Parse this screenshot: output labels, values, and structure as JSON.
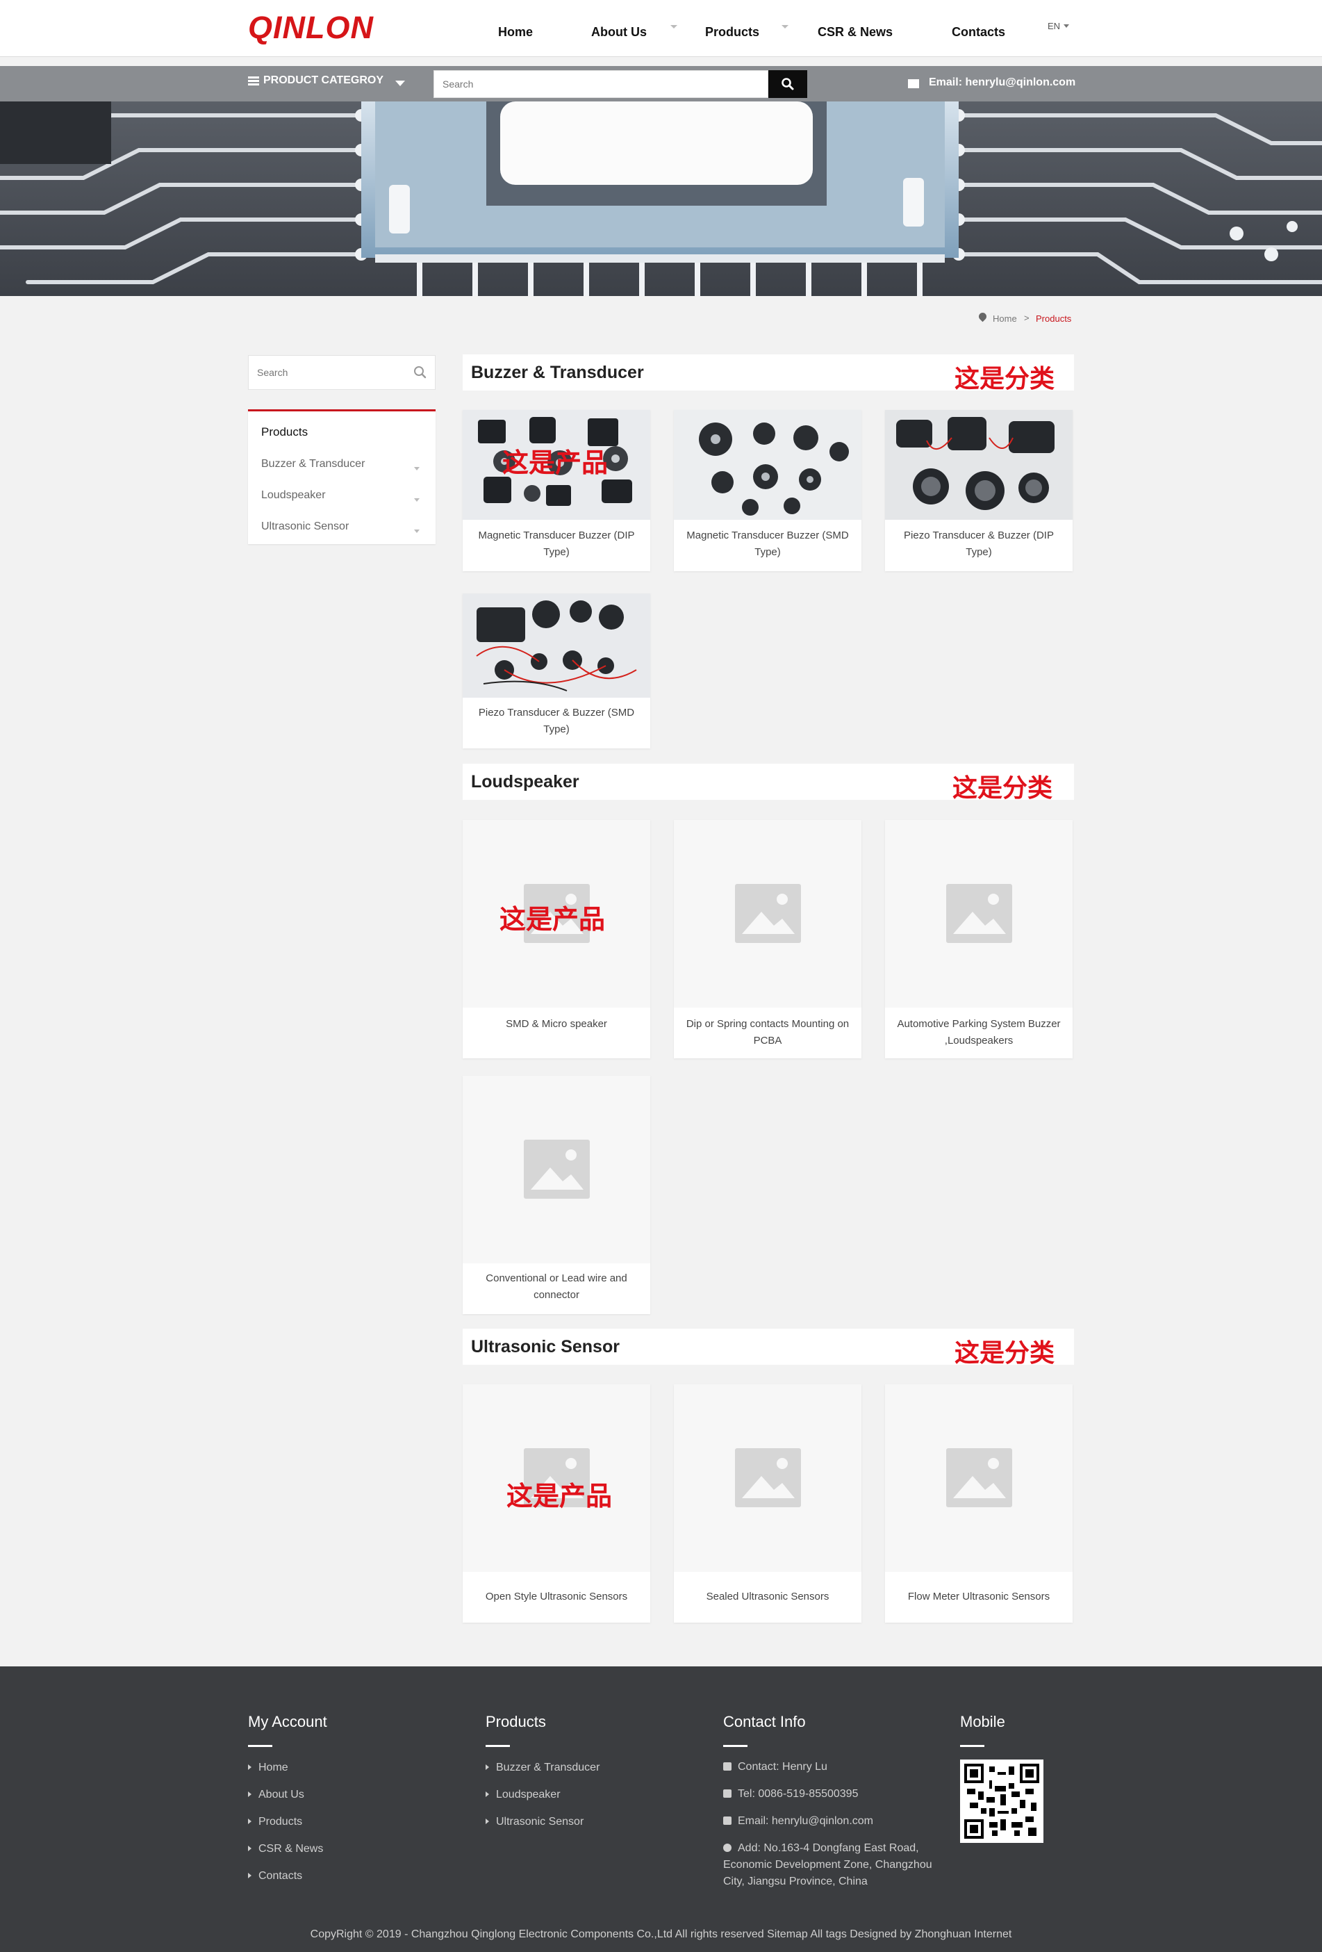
{
  "header": {
    "logo": "QINLON",
    "nav": [
      {
        "label": "Home"
      },
      {
        "label": "About Us"
      },
      {
        "label": "Products"
      },
      {
        "label": "CSR & News"
      },
      {
        "label": "Contacts"
      }
    ],
    "language": "EN"
  },
  "topbar": {
    "category_label": "PRODUCT CATEGROY",
    "search_placeholder": "Search",
    "email": "Email: henrylu@qinlon.com"
  },
  "breadcrumb": {
    "home": "Home",
    "separator": ">",
    "current": "Products"
  },
  "sidebar": {
    "search_placeholder": "Search",
    "title": "Products",
    "items": [
      {
        "label": "Buzzer & Transducer"
      },
      {
        "label": "Loudspeaker"
      },
      {
        "label": "Ultrasonic Sensor"
      }
    ]
  },
  "annotations": {
    "category": "这是分类",
    "product": "这是产品"
  },
  "sections": [
    {
      "title": "Buzzer & Transducer",
      "products": [
        {
          "name": "Magnetic Transducer Buzzer (DIP Type)"
        },
        {
          "name": "Magnetic Transducer Buzzer (SMD Type)"
        },
        {
          "name": "Piezo Transducer & Buzzer (DIP Type)"
        },
        {
          "name": "Piezo Transducer & Buzzer (SMD Type)"
        }
      ]
    },
    {
      "title": "Loudspeaker",
      "products": [
        {
          "name": "SMD & Micro speaker"
        },
        {
          "name": "Dip or Spring contacts Mounting on PCBA"
        },
        {
          "name": "Automotive Parking System Buzzer ,Loudspeakers"
        },
        {
          "name": "Conventional or Lead wire and connector"
        }
      ]
    },
    {
      "title": "Ultrasonic Sensor",
      "products": [
        {
          "name": "Open Style Ultrasonic Sensors"
        },
        {
          "name": "Sealed Ultrasonic Sensors"
        },
        {
          "name": "Flow Meter Ultrasonic Sensors"
        }
      ]
    }
  ],
  "footer": {
    "my_account": {
      "title": "My Account",
      "links": [
        "Home",
        "About Us",
        "Products",
        "CSR & News",
        "Contacts"
      ]
    },
    "products": {
      "title": "Products",
      "links": [
        "Buzzer & Transducer",
        "Loudspeaker",
        "Ultrasonic Sensor"
      ]
    },
    "contact": {
      "title": "Contact Info",
      "contact": "Contact: Henry Lu",
      "tel": "Tel: 0086-519-85500395",
      "email": "Email: henrylu@qinlon.com",
      "address": "Add: No.163-4 Dongfang East Road, Economic Development Zone, Changzhou City, Jiangsu Province, China"
    },
    "mobile": {
      "title": "Mobile"
    },
    "copyright": "CopyRight © 2019 -   Changzhou Qinglong Electronic Components Co.,Ltd  All rights reserved Sitemap  All tags   Designed by Zhonghuan Internet"
  },
  "colors": {
    "brand_red": "#d61518",
    "topbar": "#8a8d91",
    "footer": "#3b3d40"
  }
}
